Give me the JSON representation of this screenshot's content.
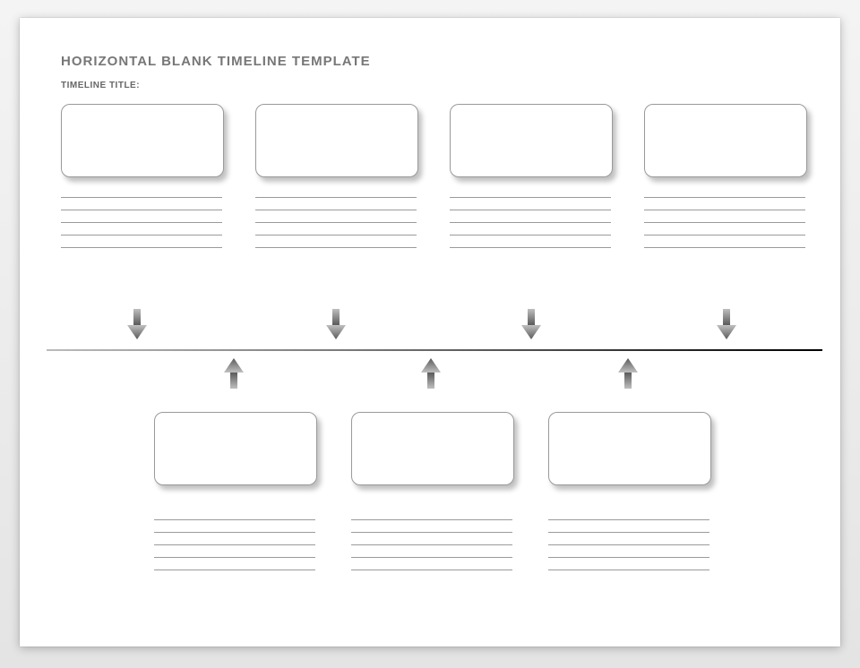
{
  "header": {
    "title": "HORIZONTAL BLANK TIMELINE TEMPLATE",
    "subtitle": "TIMELINE TITLE:"
  },
  "top_events": [
    {
      "box": "",
      "notes": [
        "",
        "",
        "",
        "",
        ""
      ]
    },
    {
      "box": "",
      "notes": [
        "",
        "",
        "",
        "",
        ""
      ]
    },
    {
      "box": "",
      "notes": [
        "",
        "",
        "",
        "",
        ""
      ]
    },
    {
      "box": "",
      "notes": [
        "",
        "",
        "",
        "",
        ""
      ]
    }
  ],
  "bottom_events": [
    {
      "box": "",
      "notes": [
        "",
        "",
        "",
        "",
        ""
      ]
    },
    {
      "box": "",
      "notes": [
        "",
        "",
        "",
        "",
        ""
      ]
    },
    {
      "box": "",
      "notes": [
        "",
        "",
        "",
        "",
        ""
      ]
    }
  ]
}
